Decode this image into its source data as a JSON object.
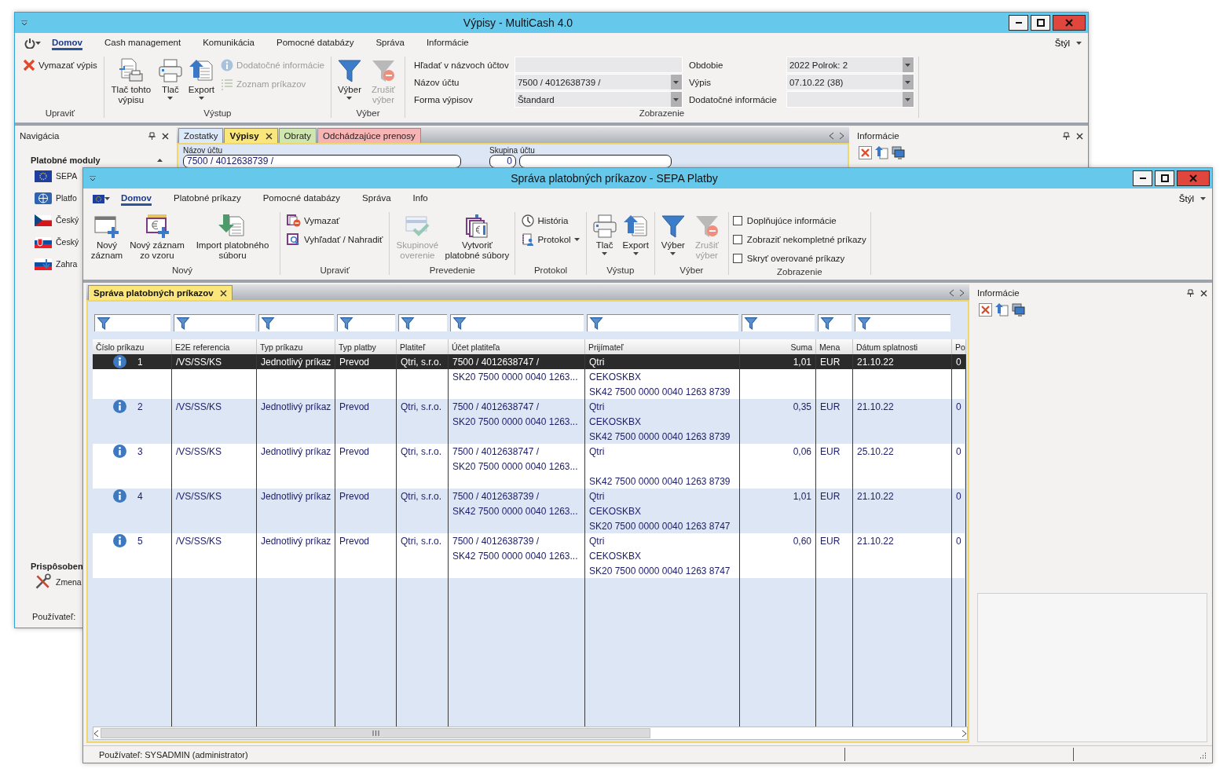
{
  "back_window": {
    "title": "Výpisy - MultiCash 4.0",
    "menu": [
      {
        "label": "Domov",
        "selected": true
      },
      {
        "label": "Cash management",
        "selected": false
      },
      {
        "label": "Komunikácia",
        "selected": false
      },
      {
        "label": "Pomocné databázy",
        "selected": false
      },
      {
        "label": "Správa",
        "selected": false
      },
      {
        "label": "Informácie",
        "selected": false
      }
    ],
    "style_menu": "Štýl",
    "ribbon": {
      "edit": {
        "label": "Upraviť",
        "items": [
          {
            "label": "Vymazať výpis"
          }
        ]
      },
      "output": {
        "label": "Výstup",
        "large": [
          {
            "label": "Tlač tohto výpisu",
            "dropdown": false
          },
          {
            "label": "Tlač",
            "dropdown": true
          },
          {
            "label": "Export",
            "dropdown": true
          }
        ],
        "small": [
          {
            "label": "Dodatočné informácie",
            "disabled": true
          },
          {
            "label": "Zoznam príkazov",
            "disabled": true
          }
        ]
      },
      "filter": {
        "label": "Výber",
        "items": [
          {
            "label": "Výber",
            "dropdown": true,
            "disabled": false
          },
          {
            "label": "Zrušiť výber",
            "dropdown": false,
            "disabled": true
          }
        ]
      },
      "view": {
        "label": "Zobrazenie",
        "fields": [
          {
            "label": "Hľadať v názvoch účtov",
            "dropdown": false
          },
          {
            "label": "Obdobie",
            "value": "2022 Polrok: 2",
            "dropdown": true
          },
          {
            "label": "Názov účtu",
            "value": "7500 / 4012638739 /",
            "dropdown": true
          },
          {
            "label": "Výpis",
            "value": "07.10.22 (38)",
            "dropdown": true
          },
          {
            "label": "Forma výpisov",
            "value": "Štandard",
            "dropdown": true
          },
          {
            "label": "Dodatočné informácie",
            "dropdown": true
          }
        ]
      }
    },
    "navigation": {
      "title": "Navigácia",
      "section": "Platobné moduly",
      "items": [
        "SEPA",
        "Platfo",
        "Český",
        "Český",
        "Zahra"
      ],
      "section_2": "Prispôsoben",
      "items_2": [
        "Zmena"
      ],
      "user": "Používateľ:"
    },
    "doc_tabs": [
      {
        "label": "Zostatky",
        "selected": false,
        "color": "#dce9f8"
      },
      {
        "label": "Výpisy",
        "selected": true,
        "color": "#fbe67c"
      },
      {
        "label": "Obraty",
        "selected": false,
        "color": "#cfe6ae"
      },
      {
        "label": "Odchádzajúce prenosy",
        "selected": false,
        "color": "#f6b4b4"
      }
    ],
    "account_filter": {
      "name_label": "Názov účtu",
      "name_value": "7500 / 4012638739 /",
      "group_label": "Skupina účtu",
      "group_value": "0"
    },
    "info_panel": {
      "title": "Informácie"
    }
  },
  "front_window": {
    "title": "Správa platobných príkazov - SEPA Platby",
    "menu": [
      {
        "label": "Domov",
        "selected": true
      },
      {
        "label": "Platobné príkazy",
        "selected": false
      },
      {
        "label": "Pomocné databázy",
        "selected": false
      },
      {
        "label": "Správa",
        "selected": false
      },
      {
        "label": "Info",
        "selected": false
      }
    ],
    "style_menu": "Štýl",
    "ribbon": {
      "new": {
        "label": "Nový",
        "items": [
          {
            "label": "Nový záznam"
          },
          {
            "label": "Nový záznam zo vzoru"
          },
          {
            "label": "Import platobného súboru"
          }
        ]
      },
      "edit": {
        "label": "Upraviť",
        "items": [
          {
            "label": "Vymazať"
          },
          {
            "label": "Vyhľadať / Nahradiť"
          }
        ]
      },
      "execute": {
        "label": "Prevedenie",
        "items": [
          {
            "label": "Skupinové overenie",
            "disabled": true
          },
          {
            "label": "Vytvoriť platobné súbory",
            "disabled": false
          }
        ]
      },
      "log": {
        "label": "Protokol",
        "items": [
          {
            "label": "História",
            "dropdown": false
          },
          {
            "label": "Protokol",
            "dropdown": true
          }
        ]
      },
      "output": {
        "label": "Výstup",
        "items": [
          {
            "label": "Tlač",
            "dropdown": true
          },
          {
            "label": "Export",
            "dropdown": true
          }
        ]
      },
      "filter": {
        "label": "Výber",
        "items": [
          {
            "label": "Výber",
            "dropdown": true,
            "disabled": false
          },
          {
            "label": "Zrušiť výber",
            "dropdown": false,
            "disabled": true
          }
        ]
      },
      "view": {
        "label": "Zobrazenie",
        "checkboxes": [
          {
            "label": "Doplňujúce informácie",
            "checked": false
          },
          {
            "label": "Zobraziť nekompletné príkazy",
            "checked": false
          },
          {
            "label": "Skryť overované príkazy",
            "checked": false
          }
        ]
      }
    },
    "doc_tab": {
      "label": "Správa platobných príkazov"
    },
    "table": {
      "columns": [
        "Číslo príkazu",
        "E2E referencia",
        "Typ príkazu",
        "Typ platby",
        "Platiteľ",
        "Účet platiteľa",
        "Prijímateľ",
        "Suma",
        "Mena",
        "Dátum splatnosti",
        "Po"
      ],
      "rows": [
        {
          "number": "1",
          "e2e": "/VS/SS/KS",
          "order_type": "Jednotlivý príkaz",
          "payment_type": "Prevod",
          "payer": "Qtri, s.r.o.",
          "payer_account": {
            "number": "7500 / 4012638747 /",
            "iban": "SK20 7500 0000 0040 1263..."
          },
          "payee": {
            "name": "Qtri",
            "bic": "CEKOSKBX",
            "iban": "SK42 7500 0000 0040 1263 8739"
          },
          "amount": "1,01",
          "currency": "EUR",
          "due_date": "21.10.22",
          "column_11": "0",
          "selected": true
        },
        {
          "number": "2",
          "e2e": "/VS/SS/KS",
          "order_type": "Jednotlivý príkaz",
          "payment_type": "Prevod",
          "payer": "Qtri, s.r.o.",
          "payer_account": {
            "number": "7500 / 4012638747 /",
            "iban": "SK20 7500 0000 0040 1263..."
          },
          "payee": {
            "name": "Qtri",
            "bic": "CEKOSKBX",
            "iban": "SK42 7500 0000 0040 1263 8739"
          },
          "amount": "0,35",
          "currency": "EUR",
          "due_date": "21.10.22",
          "column_11": "0",
          "selected": false
        },
        {
          "number": "3",
          "e2e": "/VS/SS/KS",
          "order_type": "Jednotlivý príkaz",
          "payment_type": "Prevod",
          "payer": "Qtri, s.r.o.",
          "payer_account": {
            "number": "7500 / 4012638747 /",
            "iban": "SK20 7500 0000 0040 1263..."
          },
          "payee": {
            "name": "Qtri",
            "iban": "SK42 7500 0000 0040 1263 8739"
          },
          "amount": "0,06",
          "currency": "EUR",
          "due_date": "25.10.22",
          "column_11": "0",
          "selected": false
        },
        {
          "number": "4",
          "e2e": "/VS/SS/KS",
          "order_type": "Jednotlivý príkaz",
          "payment_type": "Prevod",
          "payer": "Qtri, s.r.o.",
          "payer_account": {
            "number": "7500 / 4012638739 /",
            "iban": "SK42 7500 0000 0040 1263..."
          },
          "payee": {
            "name": "Qtri",
            "bic": "CEKOSKBX",
            "iban": "SK20 7500 0000 0040 1263 8747"
          },
          "amount": "1,01",
          "currency": "EUR",
          "due_date": "21.10.22",
          "column_11": "0",
          "selected": false
        },
        {
          "number": "5",
          "e2e": "/VS/SS/KS",
          "order_type": "Jednotlivý príkaz",
          "payment_type": "Prevod",
          "payer": "Qtri, s.r.o.",
          "payer_account": {
            "number": "7500 / 4012638739 /",
            "iban": "SK42 7500 0000 0040 1263..."
          },
          "payee": {
            "name": "Qtri",
            "bic": "CEKOSKBX",
            "iban": "SK20 7500 0000 0040 1263 8747"
          },
          "amount": "0,60",
          "currency": "EUR",
          "due_date": "21.10.22",
          "column_11": "0",
          "selected": false
        }
      ]
    },
    "info_panel": {
      "title": "Informácie"
    },
    "status_bar": "Používateľ: SYSADMIN (administrator)"
  }
}
